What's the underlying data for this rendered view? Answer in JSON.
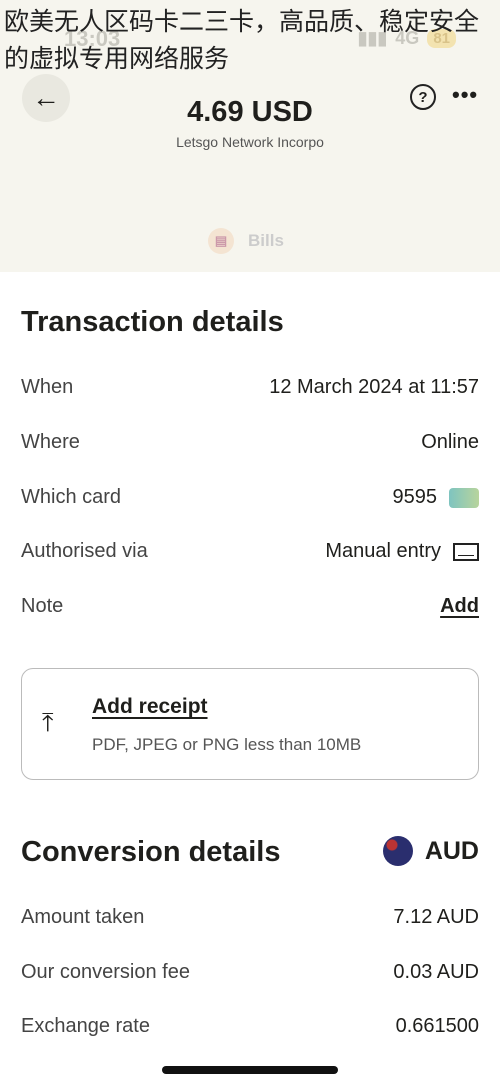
{
  "overlay_text": "欧美无人区码卡二三卡，高品质、稳定安全的虚拟专用网络服务",
  "status_bar": {
    "time": "13:03",
    "network": "4G",
    "battery": "81"
  },
  "header": {
    "amount": "4.69 USD",
    "merchant": "Letsgo Network Incorpo",
    "help_icon": "?",
    "more_icon": "•••",
    "back_icon": "←",
    "bills_label": "Bills"
  },
  "transaction": {
    "title": "Transaction details",
    "rows": [
      {
        "label": "When",
        "value": "12 March 2024 at 11:57"
      },
      {
        "label": "Where",
        "value": "Online"
      },
      {
        "label": "Which card",
        "value": "9595"
      },
      {
        "label": "Authorised via",
        "value": "Manual entry"
      },
      {
        "label": "Note",
        "value": "Add"
      }
    ]
  },
  "receipt": {
    "title": "Add receipt",
    "subtitle": "PDF, JPEG or PNG less than 10MB"
  },
  "conversion": {
    "title": "Conversion details",
    "currency": "AUD",
    "rows": [
      {
        "label": "Amount taken",
        "value": "7.12 AUD"
      },
      {
        "label": "Our conversion fee",
        "value": "0.03 AUD"
      },
      {
        "label": "Exchange rate",
        "value": "0.661500"
      }
    ]
  }
}
